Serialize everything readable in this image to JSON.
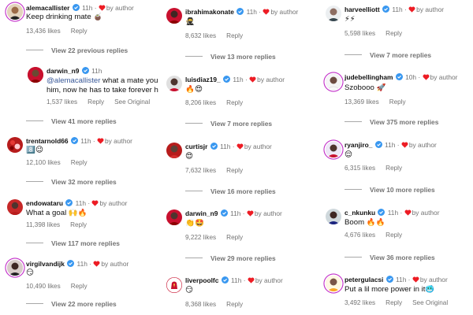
{
  "labels": {
    "by_author": "by author",
    "reply": "Reply",
    "see_original": "See Original"
  },
  "colors": {
    "verified": "#3897f0",
    "heart": "#ed1c24",
    "mention": "#385898",
    "muted": "#737373"
  },
  "columns": [
    [
      {
        "kind": "comment",
        "user": "alemacallister",
        "time": "11h",
        "text": "Keep drinking mate 🧉",
        "likes": "13,436 likes",
        "avatar": "alemac"
      },
      {
        "kind": "more",
        "text": "View 22 previous replies"
      },
      {
        "kind": "comment",
        "user": "darwin_n9",
        "time": "11h",
        "text_mention": "@alemacallister",
        "text_rest": " what a mate you",
        "text_line2": "him, now he has to take forever h",
        "likes": "1,537 likes",
        "see_original": true,
        "avatar": "darwin"
      },
      {
        "kind": "more",
        "text": "View 41 more replies"
      },
      {
        "kind": "comment",
        "user": "trentarnold66",
        "time": "11h",
        "text": "8️⃣😉",
        "likes": "12,100 likes",
        "avatar": "trent"
      },
      {
        "kind": "more",
        "text": "View 32 more replies"
      },
      {
        "kind": "comment",
        "user": "endowataru",
        "time": "11h",
        "text": "What a goal 🙌🔥",
        "likes": "11,398 likes",
        "avatar": "endo"
      },
      {
        "kind": "more",
        "text": "View 117 more replies"
      },
      {
        "kind": "comment",
        "user": "virgilvandijk",
        "time": "11h",
        "text": "😏",
        "likes": "10,490 likes",
        "avatar": "virgil"
      },
      {
        "kind": "more",
        "text": "View 22 more replies"
      }
    ],
    [
      {
        "kind": "comment",
        "user": "ibrahimakonate",
        "time": "11h",
        "text": "🥷",
        "likes": "8,632 likes",
        "avatar": "konate"
      },
      {
        "kind": "more",
        "text": "View 13 more replies"
      },
      {
        "kind": "comment",
        "user": "luisdiaz19_",
        "time": "11h",
        "text": "🔥😍",
        "likes": "8,206 likes",
        "avatar": "diaz"
      },
      {
        "kind": "more",
        "text": "View 7 more replies"
      },
      {
        "kind": "comment",
        "user": "curtisjr",
        "time": "11h",
        "text": "😍",
        "likes": "7,632 likes",
        "avatar": "curtis"
      },
      {
        "kind": "more",
        "text": "View 16 more replies"
      },
      {
        "kind": "comment",
        "user": "darwin_n9",
        "time": "11h",
        "text": "👏🤩",
        "likes": "9,222 likes",
        "avatar": "darwin"
      },
      {
        "kind": "more",
        "text": "View 29 more replies"
      },
      {
        "kind": "comment",
        "user": "liverpoolfc",
        "time": "11h",
        "text": "😏",
        "likes": "8,368 likes",
        "avatar": "lfc"
      }
    ],
    [
      {
        "kind": "comment",
        "user": "harveelliott",
        "time": "11h",
        "text": "⚡⚡",
        "likes": "5,598 likes",
        "avatar": "harvey"
      },
      {
        "kind": "more",
        "text": "View 7 more replies"
      },
      {
        "kind": "comment",
        "user": "judebellingham",
        "time": "10h",
        "text": "Szobooo 🚀",
        "likes": "13,369 likes",
        "avatar": "jude"
      },
      {
        "kind": "more",
        "text": "View 375 more replies"
      },
      {
        "kind": "comment",
        "user": "ryanjiro_",
        "time": "11h",
        "text": "😌",
        "likes": "6,315 likes",
        "avatar": "ryan"
      },
      {
        "kind": "more",
        "text": "View 10 more replies"
      },
      {
        "kind": "comment",
        "user": "c_nkunku",
        "time": "11h",
        "text": "Boom 🔥🔥",
        "likes": "4,676 likes",
        "avatar": "nkunku"
      },
      {
        "kind": "more",
        "text": "View 36 more replies"
      },
      {
        "kind": "comment",
        "user": "petergulacsi",
        "time": "11h",
        "text": "Put a lil more power in it🥶",
        "likes": "3,492 likes",
        "see_original": true,
        "avatar": "gulacsi"
      }
    ]
  ]
}
